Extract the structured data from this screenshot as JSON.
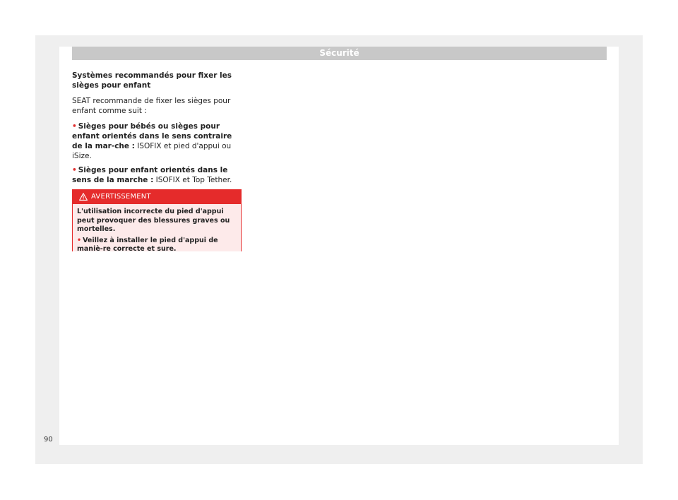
{
  "header": {
    "title": "Sécurité"
  },
  "content": {
    "heading": "Systèmes recommandés pour fixer les sièges pour enfant",
    "intro": "SEAT recommande de fixer les sièges pour enfant comme suit :",
    "bullets": [
      {
        "bold": "Sièges pour bébés ou sièges pour enfant orientés dans le sens contraire de la mar-che :",
        "text": " ISOFIX et pied d'appui ou iSize."
      },
      {
        "bold": "Sièges pour enfant orientés dans le sens de la marche :",
        "text": " ISOFIX et Top Tether."
      }
    ]
  },
  "warning": {
    "icon": "warning-triangle-icon",
    "title": "AVERTISSEMENT",
    "text": "L'utilisation incorrecte du pied d'appui peut provoquer des blessures graves ou mortelles.",
    "bullet": "Veillez à installer le pied d'appui de maniè-re correcte et sure."
  },
  "page_number": "90",
  "colors": {
    "accent_red": "#e52b2b",
    "header_gray": "#c8c8c8"
  }
}
